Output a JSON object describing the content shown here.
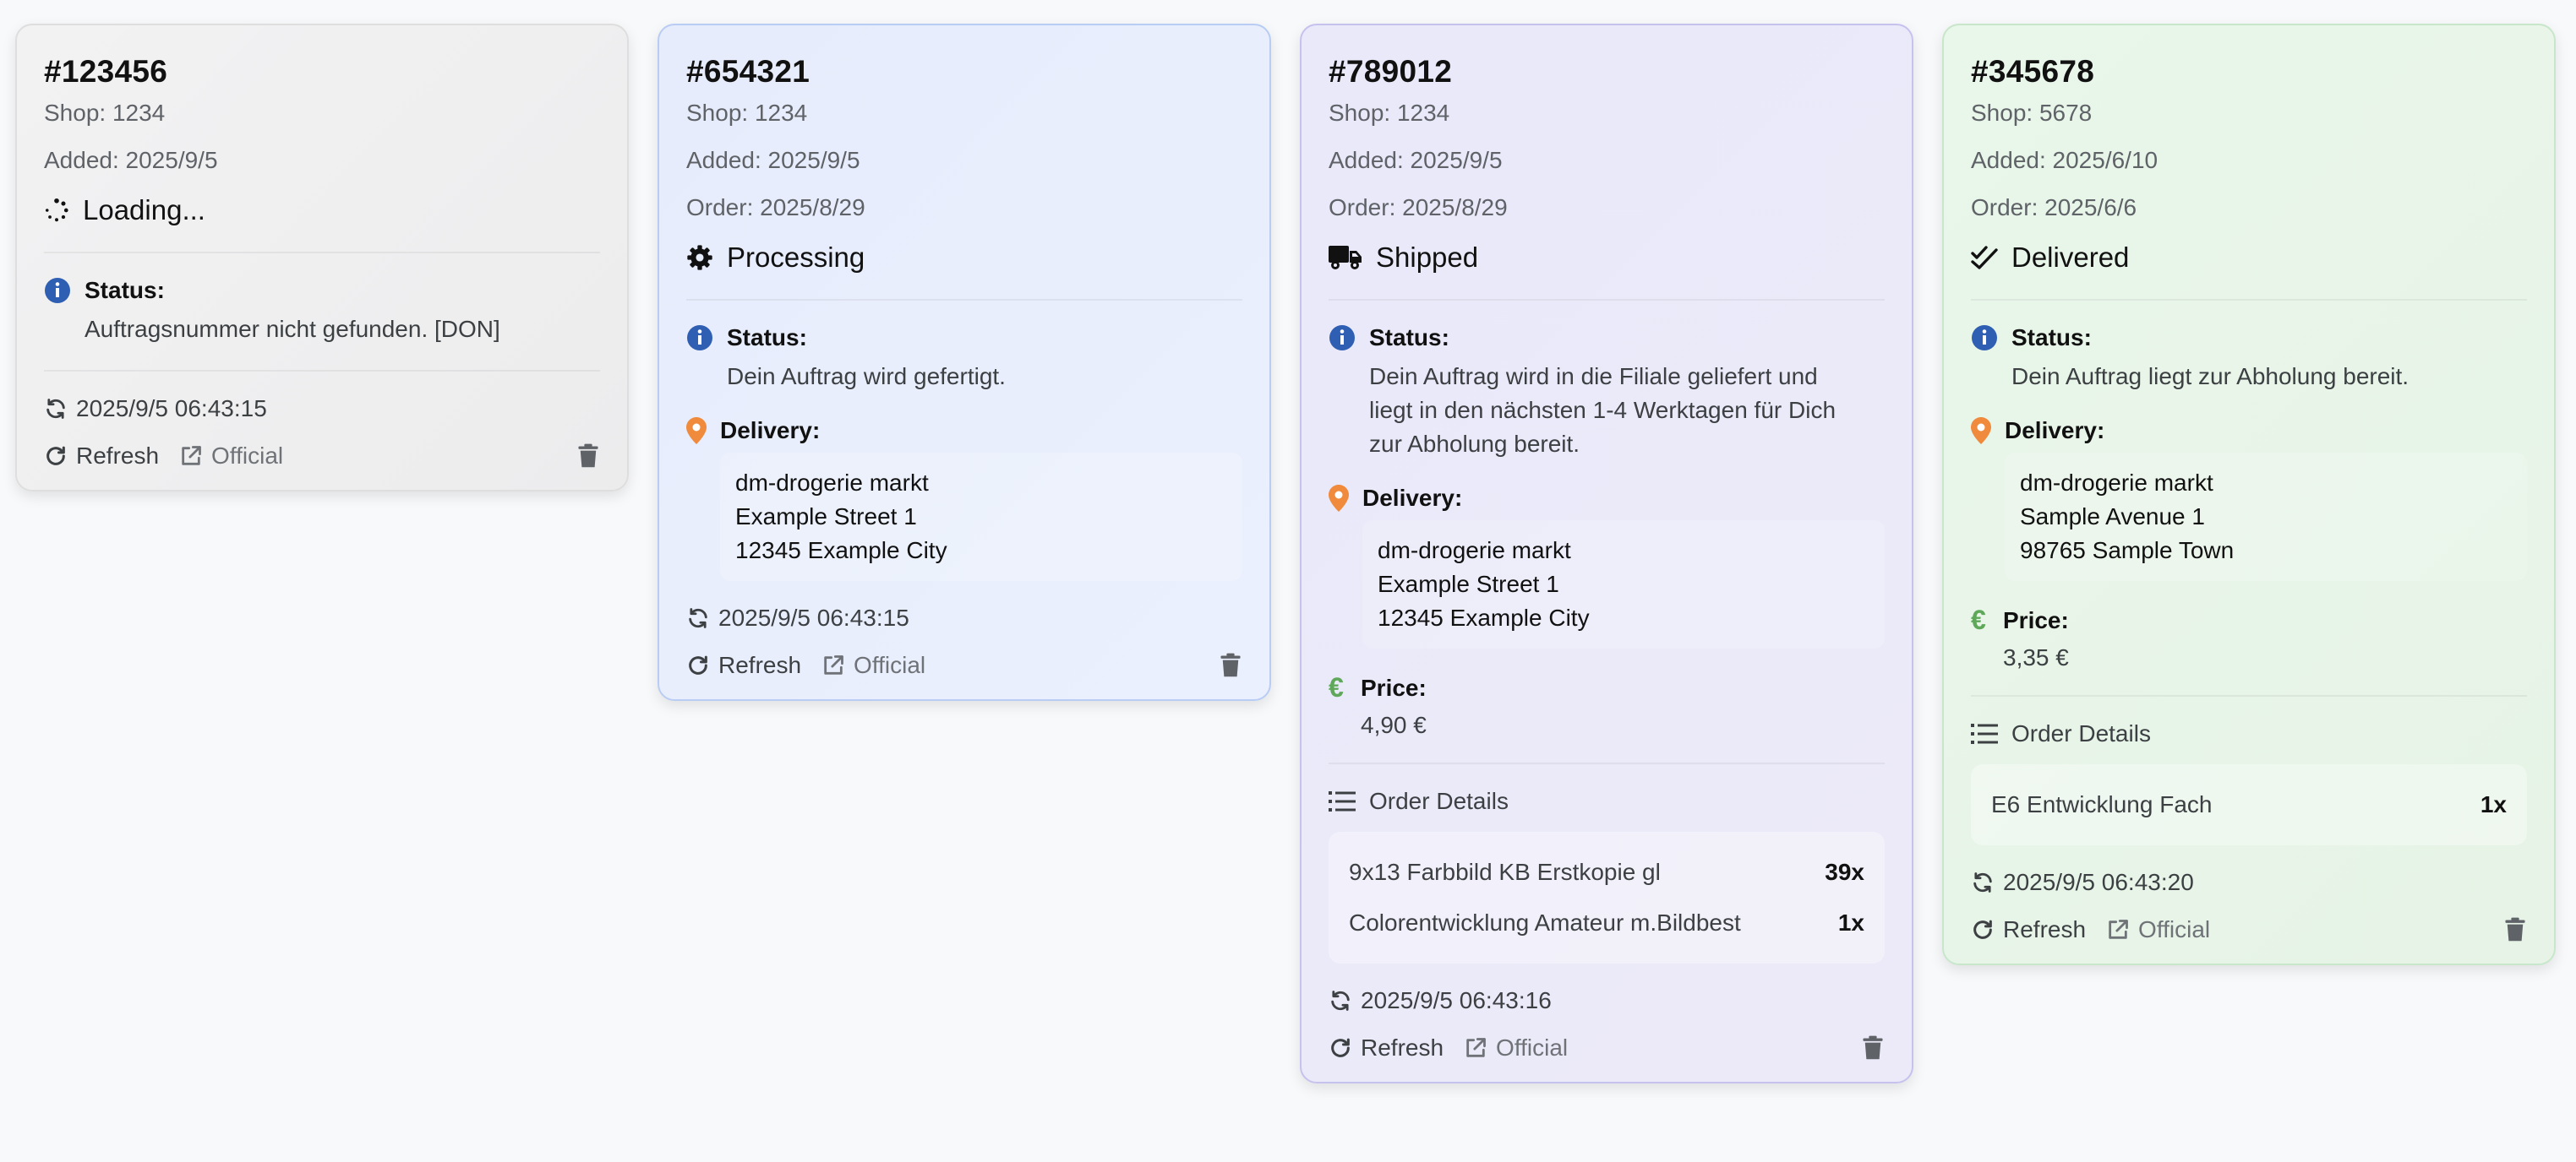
{
  "cards": [
    {
      "order_no": "#123456",
      "shop": "Shop: 1234",
      "added": "Added: 2025/9/5",
      "state": "Loading...",
      "status_label": "Status:",
      "status_text": "Auftragsnummer nicht gefunden. [DON]",
      "updated": "2025/9/5 06:43:15",
      "refresh": "Refresh",
      "official": "Official"
    },
    {
      "order_no": "#654321",
      "shop": "Shop: 1234",
      "added": "Added: 2025/9/5",
      "order": "Order: 2025/8/29",
      "state": "Processing",
      "status_label": "Status:",
      "status_text": "Dein Auftrag wird gefertigt.",
      "delivery_label": "Delivery:",
      "address": [
        "dm-drogerie markt",
        "Example Street 1",
        "12345 Example City"
      ],
      "updated": "2025/9/5 06:43:15",
      "refresh": "Refresh",
      "official": "Official"
    },
    {
      "order_no": "#789012",
      "shop": "Shop: 1234",
      "added": "Added: 2025/9/5",
      "order": "Order: 2025/8/29",
      "state": "Shipped",
      "status_label": "Status:",
      "status_text_lines": [
        "Dein Auftrag wird in die Filiale geliefert und",
        "liegt in den nächsten 1-4 Werktagen für Dich",
        "zur Abholung bereit."
      ],
      "delivery_label": "Delivery:",
      "address": [
        "dm-drogerie markt",
        "Example Street 1",
        "12345 Example City"
      ],
      "price_label": "Price:",
      "price": "4,90 €",
      "order_details_label": "Order Details",
      "items": [
        {
          "name": "9x13 Farbbild KB Erstkopie gl",
          "qty": "39x"
        },
        {
          "name": "Colorentwicklung Amateur m.Bildbest",
          "qty": "1x"
        }
      ],
      "updated": "2025/9/5 06:43:16",
      "refresh": "Refresh",
      "official": "Official"
    },
    {
      "order_no": "#345678",
      "shop": "Shop: 5678",
      "added": "Added: 2025/6/10",
      "order": "Order: 2025/6/6",
      "state": "Delivered",
      "status_label": "Status:",
      "status_text": "Dein Auftrag liegt zur Abholung bereit.",
      "delivery_label": "Delivery:",
      "address": [
        "dm-drogerie markt",
        "Sample Avenue 1",
        "98765 Sample Town"
      ],
      "price_label": "Price:",
      "price": "3,35 €",
      "order_details_label": "Order Details",
      "items": [
        {
          "name": "E6 Entwicklung Fach",
          "qty": "1x"
        }
      ],
      "updated": "2025/9/5 06:43:20",
      "refresh": "Refresh",
      "official": "Official"
    }
  ],
  "colors": {
    "info_blue": "#2f5fb3",
    "pin_orange": "#f08a3c",
    "euro_green": "#5fa85a",
    "icon_gray": "#5f6368"
  },
  "icons": {
    "loading": "spinner-icon",
    "processing": "gear-icon",
    "shipped": "truck-icon",
    "delivered": "double-check-icon",
    "status": "info-icon",
    "delivery": "map-pin-icon",
    "price": "euro-icon",
    "order_details": "list-icon",
    "updated": "sync-icon",
    "refresh": "refresh-icon",
    "official": "external-link-icon",
    "delete": "trash-icon"
  }
}
